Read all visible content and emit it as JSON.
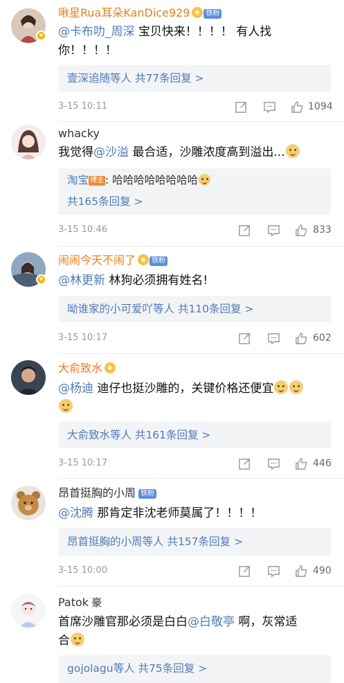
{
  "comments": [
    {
      "username": "啾星Rua耳朵KanDice929",
      "fan_tag": "铁粉",
      "mention": "@卡布叻_周深",
      "text_line1_rest": " 宝贝快来！！！！ 有人找",
      "text_line2": "你！！！！",
      "reply_summary_user": "壹深追随等人",
      "reply_summary_count": " 共77条回复 >",
      "time": "3-15 10:11",
      "likes": "1094"
    },
    {
      "username": "whacky",
      "text_prefix": "我觉得",
      "mention": "@沙溢",
      "text_rest": " 最合适，沙雕浓度高到溢出...",
      "sub_reply_user": "淘宝",
      "sub_reply_badge": "博主",
      "sub_reply_text": ": 哈哈哈哈哈哈哈哈",
      "reply_summary_count": "共165条回复 >",
      "time": "3-15 10:46",
      "likes": "833"
    },
    {
      "username": "闹闹今天不闹了",
      "fan_tag": "铁粉",
      "mention": "@林更新",
      "text_rest": " 林狗必须拥有姓名!",
      "reply_summary_user": "呦谁家的小可爱吖等人",
      "reply_summary_count": " 共110条回复 >",
      "time": "3-15 10:17",
      "likes": "602"
    },
    {
      "username": "大俞致水",
      "mention": "@杨迪",
      "text_rest": " 迪仔也挺沙雕的，关键价格还便宜",
      "reply_summary_user": "大俞致水等人",
      "reply_summary_count": " 共161条回复 >",
      "time": "3-15 10:17",
      "likes": "446"
    },
    {
      "username": "昂首挺胸的小周",
      "fan_tag": "铁粉",
      "mention": "@沈腾",
      "text_rest": " 那肯定非沈老师莫属了！！！！",
      "reply_summary_user": "昂首挺胸的小周等人",
      "reply_summary_count": " 共157条回复 >",
      "time": "3-15 10:00",
      "likes": "490"
    },
    {
      "username": "Patok",
      "title_suffix": "豪",
      "text_prefix": "首席沙雕官那必须是白白",
      "mention": "@白敬亭",
      "text_rest": " 啊，灰常适",
      "text_line2": "合",
      "reply_summary_user": "gojolagu等人",
      "reply_summary_count": " 共75条回复 >"
    }
  ],
  "colors": {
    "link_blue": "#4f7bb5",
    "name_orange": "#e87d1c",
    "reply_bg": "#f3f4f6",
    "meta_gray": "#999999"
  },
  "icons": [
    "share-icon",
    "comment-icon",
    "like-icon",
    "v-badge-icon",
    "fan-badge-icon",
    "doge-emoji-icon"
  ]
}
